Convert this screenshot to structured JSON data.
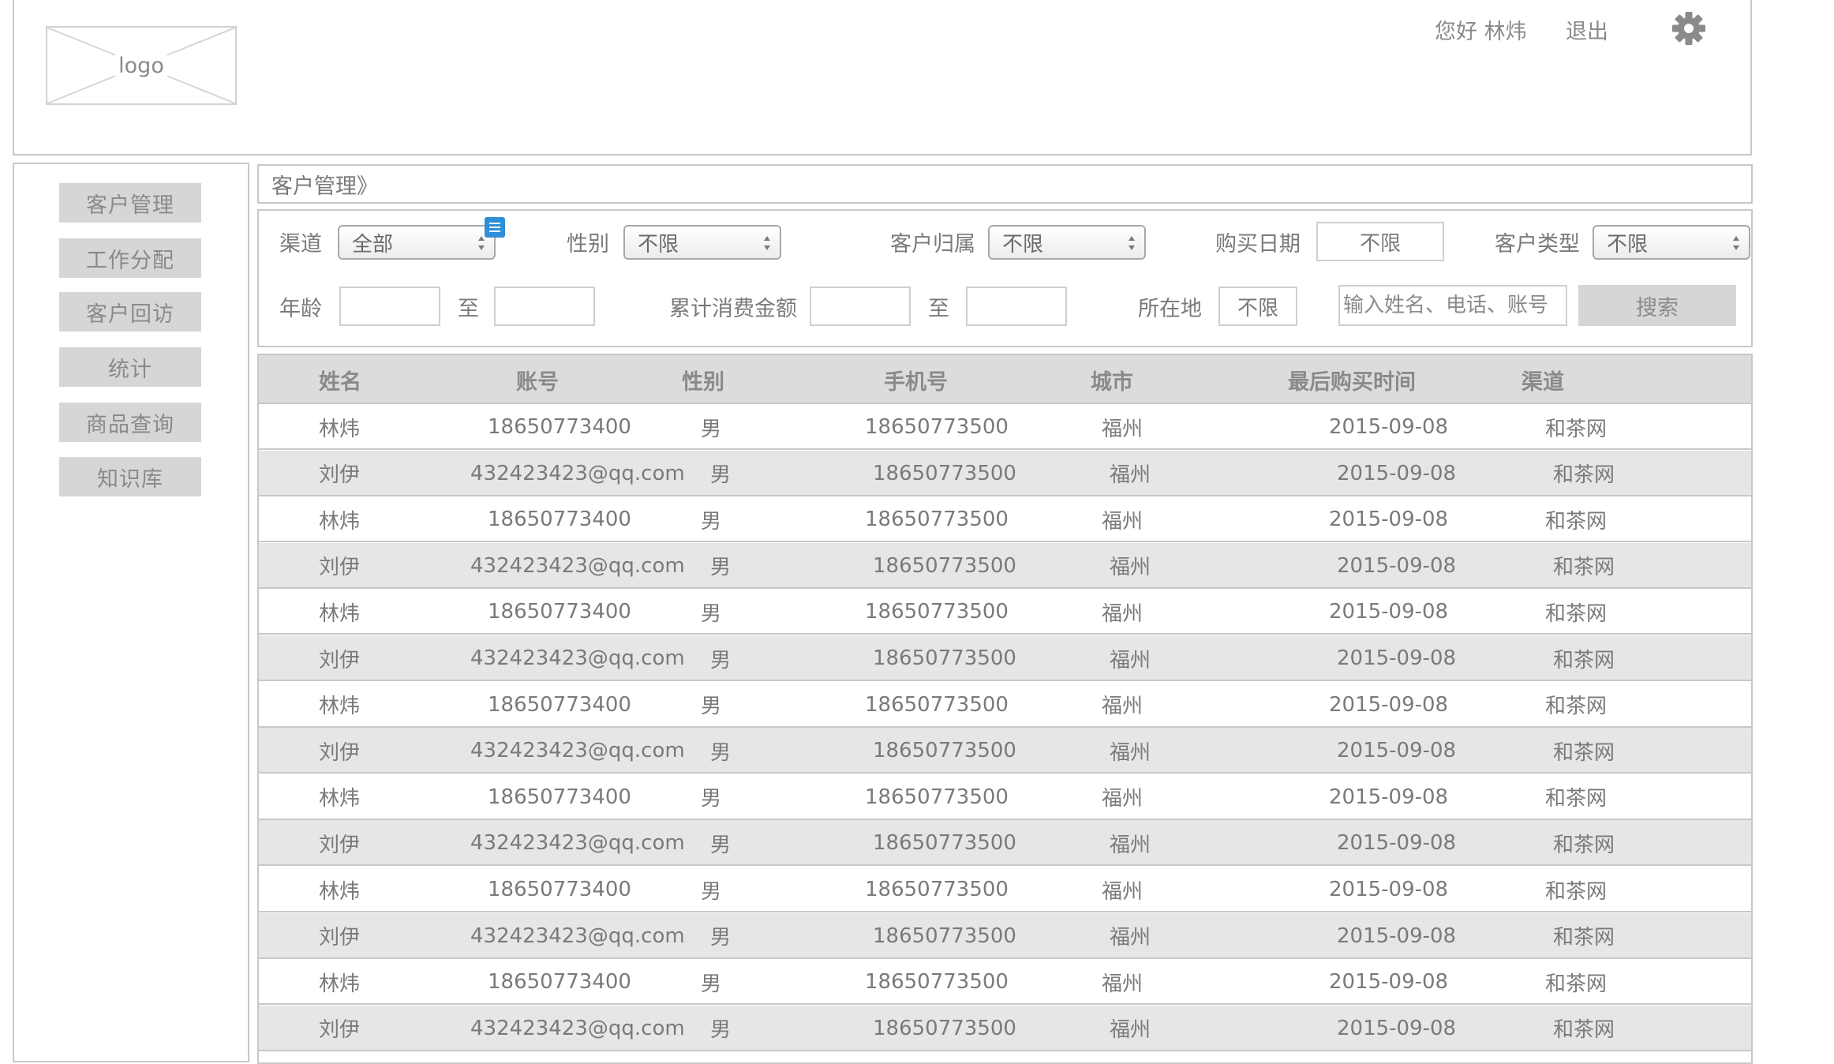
{
  "header": {
    "logo_text": "logo",
    "greeting": "您好 林炜",
    "logout_label": "退出"
  },
  "sidebar": {
    "items": [
      {
        "label": "客户管理"
      },
      {
        "label": "工作分配"
      },
      {
        "label": "客户回访"
      },
      {
        "label": "统计"
      },
      {
        "label": "商品查询"
      },
      {
        "label": "知识库"
      }
    ]
  },
  "breadcrumb": "客户管理》",
  "filters": {
    "channel_label": "渠道",
    "channel_value": "全部",
    "gender_label": "性别",
    "gender_value": "不限",
    "owner_label": "客户归属",
    "owner_value": "不限",
    "purchase_date_label": "购买日期",
    "purchase_date_value": "不限",
    "customer_type_label": "客户类型",
    "customer_type_value": "不限",
    "age_label": "年龄",
    "age_to": "至",
    "spend_label": "累计消费金额",
    "spend_to": "至",
    "location_label": "所在地",
    "location_value": "不限",
    "search_placeholder": "输入姓名、电话、账号",
    "search_button": "搜索"
  },
  "table": {
    "columns": [
      "姓名",
      "账号",
      "性别",
      "手机号",
      "城市",
      "最后购买时间",
      "渠道"
    ],
    "rows": [
      [
        "林炜",
        "18650773400",
        "男",
        "18650773500",
        "福州",
        "2015-09-08",
        "和茶网"
      ],
      [
        "刘伊",
        "432423423@qq.com",
        "男",
        "18650773500",
        "福州",
        "2015-09-08",
        "和茶网"
      ],
      [
        "林炜",
        "18650773400",
        "男",
        "18650773500",
        "福州",
        "2015-09-08",
        "和茶网"
      ],
      [
        "刘伊",
        "432423423@qq.com",
        "男",
        "18650773500",
        "福州",
        "2015-09-08",
        "和茶网"
      ],
      [
        "林炜",
        "18650773400",
        "男",
        "18650773500",
        "福州",
        "2015-09-08",
        "和茶网"
      ],
      [
        "刘伊",
        "432423423@qq.com",
        "男",
        "18650773500",
        "福州",
        "2015-09-08",
        "和茶网"
      ],
      [
        "林炜",
        "18650773400",
        "男",
        "18650773500",
        "福州",
        "2015-09-08",
        "和茶网"
      ],
      [
        "刘伊",
        "432423423@qq.com",
        "男",
        "18650773500",
        "福州",
        "2015-09-08",
        "和茶网"
      ],
      [
        "林炜",
        "18650773400",
        "男",
        "18650773500",
        "福州",
        "2015-09-08",
        "和茶网"
      ],
      [
        "刘伊",
        "432423423@qq.com",
        "男",
        "18650773500",
        "福州",
        "2015-09-08",
        "和茶网"
      ],
      [
        "林炜",
        "18650773400",
        "男",
        "18650773500",
        "福州",
        "2015-09-08",
        "和茶网"
      ],
      [
        "刘伊",
        "432423423@qq.com",
        "男",
        "18650773500",
        "福州",
        "2015-09-08",
        "和茶网"
      ],
      [
        "林炜",
        "18650773400",
        "男",
        "18650773500",
        "福州",
        "2015-09-08",
        "和茶网"
      ],
      [
        "刘伊",
        "432423423@qq.com",
        "男",
        "18650773500",
        "福州",
        "2015-09-08",
        "和茶网"
      ]
    ]
  }
}
